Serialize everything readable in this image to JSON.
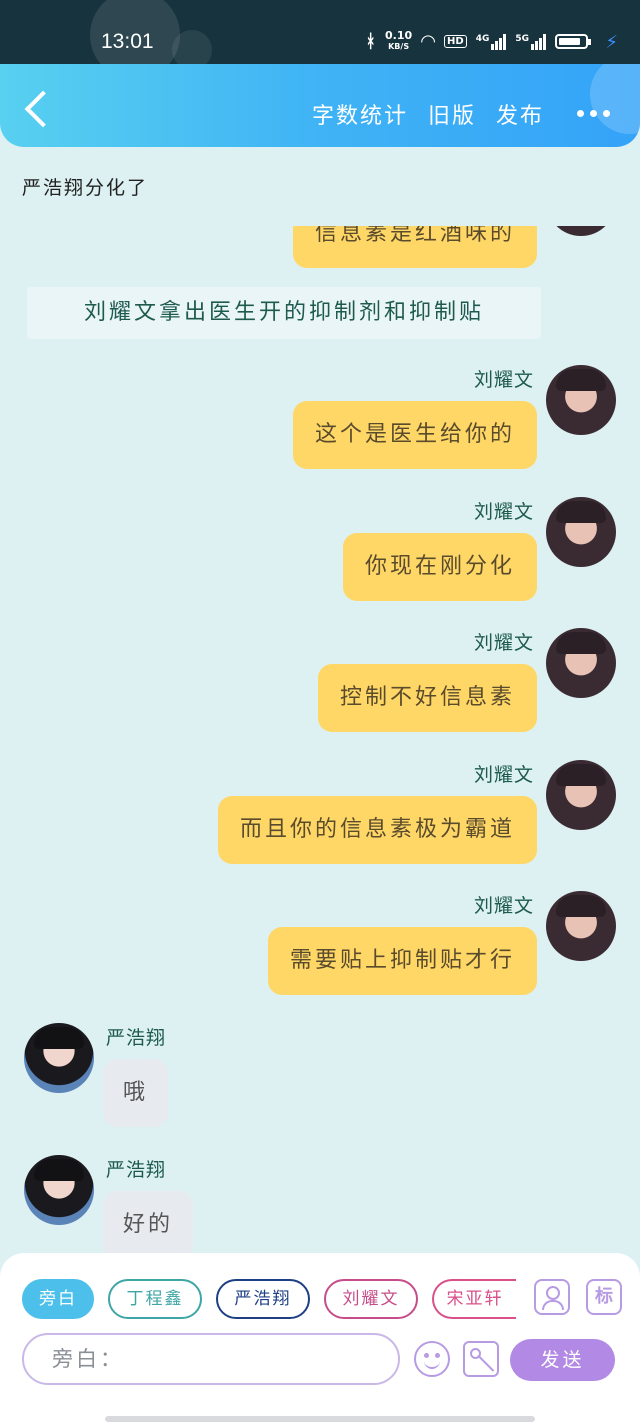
{
  "status_bar": {
    "time": "13:01",
    "net_speed_value": "0.10",
    "net_speed_unit": "KB/S",
    "hd_badge": "HD",
    "sim1_label": "4G",
    "sim2_label": "5G",
    "icons": [
      "bluetooth-icon",
      "wifi-icon",
      "signal-icon",
      "battery-icon",
      "charging-icon"
    ]
  },
  "header": {
    "actions": [
      "字数统计",
      "旧版",
      "发布"
    ],
    "back_icon": "chevron-left-icon",
    "more_icon": "more-dots-icon"
  },
  "chat": {
    "title": "严浩翔分化了",
    "partial_bubble": "信息素是红酒味的",
    "narration": "刘耀文拿出医生开的抑制剂和抑制贴",
    "messages": [
      {
        "speaker": "刘耀文",
        "text": "这个是医生给你的"
      },
      {
        "speaker": "刘耀文",
        "text": "你现在刚分化"
      },
      {
        "speaker": "刘耀文",
        "text": "控制不好信息素"
      },
      {
        "speaker": "刘耀文",
        "text": "而且你的信息素极为霸道"
      },
      {
        "speaker": "刘耀文",
        "text": "需要贴上抑制贴才行"
      },
      {
        "speaker": "严浩翔",
        "text": "哦"
      },
      {
        "speaker": "严浩翔",
        "text": "好的"
      }
    ]
  },
  "composer": {
    "roles": [
      "旁白",
      "丁程鑫",
      "严浩翔",
      "刘耀文",
      "宋亚轩"
    ],
    "tag_button": "标",
    "input_placeholder": "旁白：",
    "send_label": "发送"
  }
}
